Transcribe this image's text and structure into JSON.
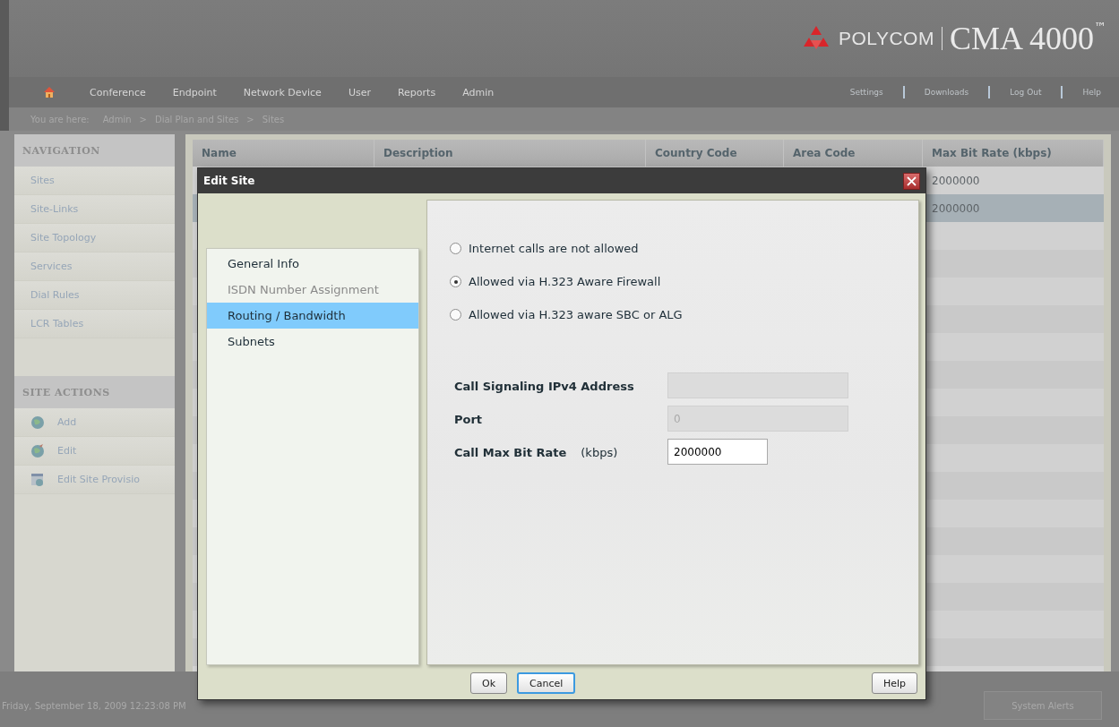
{
  "header": {
    "brand": "POLYCOM",
    "product": "CMA 4000",
    "trademark": "™"
  },
  "nav": {
    "items": [
      "Conference",
      "Endpoint",
      "Network Device",
      "User",
      "Reports",
      "Admin"
    ],
    "links": [
      "Settings",
      "Downloads",
      "Log Out",
      "Help"
    ]
  },
  "breadcrumb": {
    "prefix": "You are here:",
    "separator": ">",
    "items": [
      "Admin",
      "Dial Plan and Sites",
      "Sites"
    ]
  },
  "sidebar": {
    "sections": [
      {
        "title": "NAVIGATION",
        "items": [
          {
            "label": "Sites"
          },
          {
            "label": "Site-Links"
          },
          {
            "label": "Site Topology"
          },
          {
            "label": "Services"
          },
          {
            "label": "Dial Rules"
          },
          {
            "label": "LCR Tables"
          }
        ]
      },
      {
        "title": "SITE ACTIONS",
        "items": [
          {
            "label": "Add",
            "kind": "add"
          },
          {
            "label": "Edit",
            "kind": "edit"
          },
          {
            "label": "Edit Site Provisio",
            "kind": "provision"
          }
        ]
      }
    ]
  },
  "table": {
    "columns": [
      "Name",
      "Description",
      "Country Code",
      "Area Code",
      "Max Bit Rate (kbps)"
    ],
    "rows": [
      {
        "max_bit_rate": "2000000",
        "selected": false
      },
      {
        "max_bit_rate": "2000000",
        "selected": true
      }
    ]
  },
  "dialog": {
    "title": "Edit Site",
    "sections": [
      {
        "label": "General Info",
        "selected": false,
        "disabled": false
      },
      {
        "label": "ISDN Number Assignment",
        "selected": false,
        "disabled": true
      },
      {
        "label": "Routing / Bandwidth",
        "selected": true,
        "disabled": false
      },
      {
        "label": "Subnets",
        "selected": false,
        "disabled": false
      }
    ],
    "radios": [
      {
        "label": "Internet calls are not allowed",
        "selected": false
      },
      {
        "label": "Allowed via H.323 Aware Firewall",
        "selected": true
      },
      {
        "label": "Allowed via H.323 aware SBC or ALG",
        "selected": false
      }
    ],
    "fields": [
      {
        "label": "Call Signaling IPv4 Address",
        "disabled": true
      },
      {
        "label": "Port",
        "value": "0",
        "disabled": true
      },
      {
        "label": "Call Max Bit Rate",
        "unit": "(kbps)",
        "value": "2000000",
        "disabled": false
      }
    ],
    "buttons": [
      {
        "label": "Ok",
        "focused": false
      },
      {
        "label": "Cancel",
        "focused": true
      }
    ],
    "help_button": "Help"
  },
  "footer": {
    "datetime": "Friday, September 18, 2009 12:23:08 PM",
    "alerts_button": "System Alerts"
  }
}
